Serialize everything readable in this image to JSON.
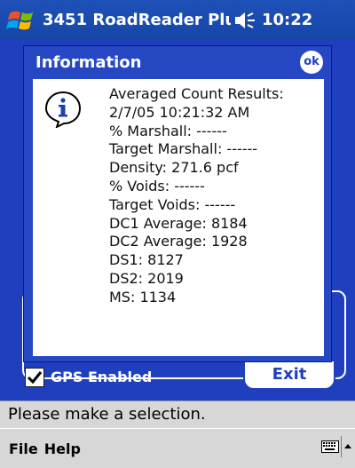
{
  "titlebar": {
    "start_icon": "windows-flag-icon",
    "title": "3451 RoadReader Plu:",
    "speaker_icon": "speaker-icon",
    "time": "10:22"
  },
  "dialog": {
    "title": "Information",
    "ok_label": "ok",
    "icon": "information-icon",
    "lines": [
      "Averaged Count Results:",
      "2/7/05 10:21:32 AM",
      "% Marshall: ------",
      "Target Marshall: ------",
      "Density: 271.6 pcf",
      "% Voids: ------",
      "Target Voids: ------",
      "DC1 Average: 8184",
      "DC2 Average: 1928",
      "DS1: 8127",
      "DS2: 2019",
      "MS: 1134"
    ]
  },
  "app": {
    "gps_label": "GPS Enabled",
    "gps_checked": true,
    "exit_label": "Exit"
  },
  "status": {
    "text": "Please make a selection."
  },
  "menubar": {
    "file_label": "File",
    "help_label": "Help",
    "keyboard_icon": "keyboard-icon",
    "sip_arrow_icon": "arrow-up-icon"
  },
  "colors": {
    "title_blue": "#1e51b8",
    "app_blue": "#1f3fbf",
    "dialog_blue": "#2647c4",
    "bar_gray": "#d7d7d7"
  }
}
